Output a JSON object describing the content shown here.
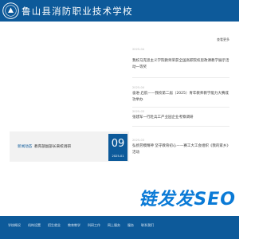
{
  "header": {
    "site_title": "鲁山县消防职业技术学校",
    "brand_color": "#0d5a9a",
    "logo_icon": "school-seal-icon"
  },
  "news": {
    "more_label": "查看更多",
    "items": [
      {
        "date": "2025-04",
        "title": "我校马克思主义学院教师荣获全国高职院校思政课教学展示活动一等奖"
      },
      {
        "date": "2025-04",
        "title": "奋进·启航——我校第二届（2025）青年教师教学能力大赛成功举办"
      },
      {
        "date": "2025-03",
        "title": "张建军一行赴兵工产业园企业考察调研"
      },
      {
        "date": "2025-03",
        "title": "弘扬劳模精神 坚守教育初心——赛工大工会组织《我的家乡》活动"
      }
    ]
  },
  "slide": {
    "tag": "新闻动态",
    "title": "教育部副部长来校调研",
    "day": "09",
    "year_month": "2025-01"
  },
  "footer": {
    "links": [
      "学校概况",
      "机构设置",
      "招生就业",
      "教育教学",
      "科研工作",
      "网上服务",
      "服务",
      "联系我们"
    ]
  },
  "watermark": {
    "text": "链发发SEO",
    "color": "#0a7ad6"
  }
}
